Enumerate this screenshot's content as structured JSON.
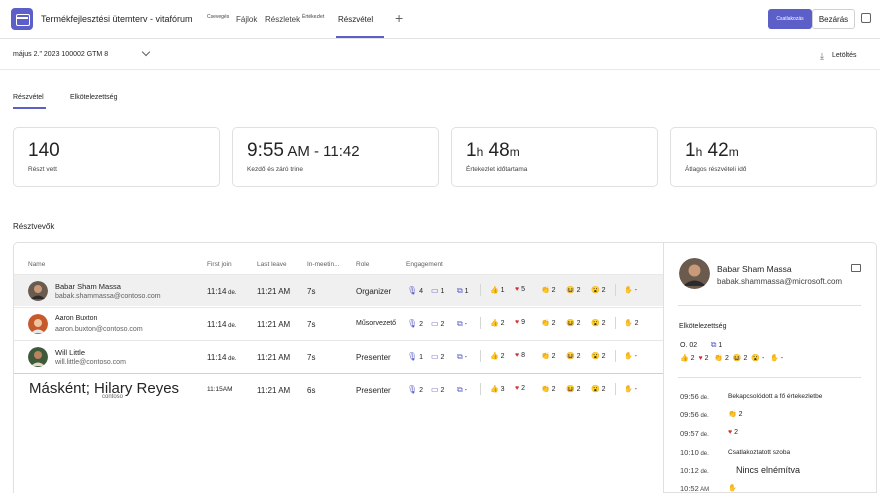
{
  "header": {
    "meeting_title": "Termékfejlesztési ütemterv - vitafórum",
    "tabs": [
      {
        "label": "Csevegés"
      },
      {
        "label": "Fájlok"
      },
      {
        "label": "Részletek"
      },
      {
        "label": "Értékezlet"
      },
      {
        "label": "Részvétel"
      }
    ],
    "add_tab": "+",
    "join_label": "Csatlakozás",
    "close_label": "Bezárás"
  },
  "datebar": {
    "date": "május 2.\" 2023 100002 GTM 8",
    "download_label": "Letöltés"
  },
  "subtabs": [
    {
      "label": "Részvétel"
    },
    {
      "label": "Elkötelezettség"
    }
  ],
  "cards": [
    {
      "value": "140",
      "unit1": "",
      "value2": "",
      "unit2": "",
      "label": "Részt vett"
    },
    {
      "value": "9:55",
      "unit1": " AM - 11:42",
      "value2": "",
      "unit2": "",
      "label": "Kezdő és záró trine"
    },
    {
      "value": "1",
      "unit1": "h",
      "value2": " 48",
      "unit2": "m",
      "label": "Értekezlet időtartama"
    },
    {
      "value": "1",
      "unit1": "h",
      "value2": " 42",
      "unit2": "m",
      "label": "Átlagos részvételi idő"
    }
  ],
  "section_title": "Résztvevők",
  "table": {
    "headers": [
      "Name",
      "First join",
      "Last leave",
      "In-meetin...",
      "Role",
      "Engagement"
    ],
    "rows": [
      {
        "name": "Babar Sham Massa",
        "email": "babak.shammassa@contoso.com",
        "join": "11:14",
        "join_suffix": " de.",
        "leave": "11:21 AM",
        "duration": "7s",
        "role": "Organizer",
        "mic": "4",
        "cam": "1",
        "share": "1",
        "like": "1",
        "heart": "5",
        "clap": "2",
        "laugh": "2",
        "wow": "2",
        "hand": "-"
      },
      {
        "name": "Aaron Buxton",
        "email": "aaron.buxton@contoso.com",
        "join": "11:14",
        "join_suffix": " de.",
        "leave": "11:21 AM",
        "duration": "7s",
        "role": "Műsorvezető",
        "mic": "2",
        "cam": "2",
        "share": "-",
        "like": "2",
        "heart": "9",
        "clap": "2",
        "laugh": "2",
        "wow": "2",
        "hand": "2"
      },
      {
        "name": "Will Little",
        "email": "will.little@contoso.com",
        "join": "11:14",
        "join_suffix": " de.",
        "leave": "11:21 AM",
        "duration": "7s",
        "role": "Presenter",
        "mic": "1",
        "cam": "2",
        "share": "-",
        "like": "2",
        "heart": "8",
        "clap": "2",
        "laugh": "2",
        "wow": "2",
        "hand": "-"
      },
      {
        "name": "Másként; Hilary Reyes",
        "email": "contoso",
        "join": "11:15AM",
        "join_suffix": "",
        "leave": "11:21 AM",
        "duration": "6s",
        "role": "Presenter",
        "mic": "2",
        "cam": "2",
        "share": "-",
        "like": "3",
        "heart": "2",
        "clap": "2",
        "laugh": "2",
        "wow": "2",
        "hand": "-"
      }
    ]
  },
  "detail": {
    "name": "Babar Sham Massa",
    "email": "babak.shammassa@microsoft.com",
    "engagement_title": "Elkötelezettség",
    "eng_line1": {
      "mic": "O. 02",
      "share": "1"
    },
    "eng_line2": {
      "like": "2",
      "heart": "2",
      "clap": "2",
      "laugh": "2",
      "wow": "-",
      "hand": "-"
    },
    "timeline": [
      {
        "time": "09:56",
        "suffix": " de.",
        "text": "Bekapcsolódott a fő értekezletbe"
      },
      {
        "time": "09:56",
        "suffix": " de.",
        "text": "2"
      },
      {
        "time": "09:57",
        "suffix": " de.",
        "text": "2"
      },
      {
        "time": "10:10",
        "suffix": " de.",
        "text": "Csatlakoztatott szoba"
      },
      {
        "time": "10:12",
        "suffix": " de.",
        "text": "Nincs elnémítva"
      },
      {
        "time": "10:52",
        "suffix": " AM",
        "text": ""
      }
    ]
  },
  "colors": {
    "accent": "#5b5fc7",
    "heart": "#d13438"
  }
}
